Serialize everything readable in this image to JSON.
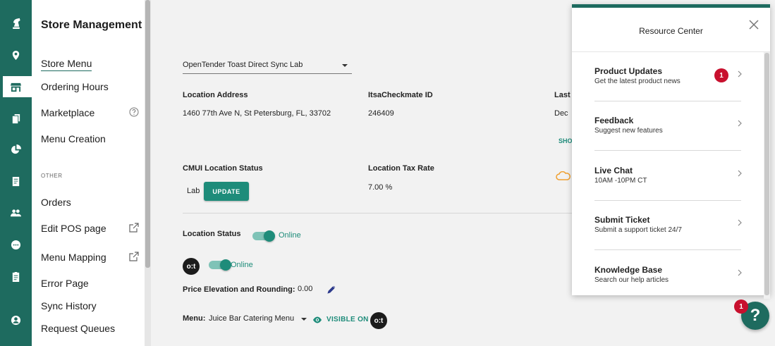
{
  "rail": {
    "items": [
      {
        "icon": "chess-knight-logo-icon"
      },
      {
        "icon": "location-pin-icon"
      },
      {
        "icon": "store-icon",
        "active": true
      },
      {
        "icon": "menu-board-icon"
      },
      {
        "icon": "pie-chart-icon"
      },
      {
        "icon": "receipt-icon"
      },
      {
        "icon": "users-icon"
      },
      {
        "icon": "chat-bubble-icon"
      },
      {
        "icon": "clipboard-icon"
      },
      {
        "icon": "account-icon"
      }
    ]
  },
  "sidebar": {
    "title": "Store Management",
    "items": [
      {
        "label": "Store Menu"
      },
      {
        "label": "Ordering Hours"
      },
      {
        "label": "Marketplace"
      },
      {
        "label": "Menu Creation"
      }
    ],
    "section_label": "OTHER",
    "other_items": [
      {
        "label": "Orders"
      },
      {
        "label": "Edit POS page"
      },
      {
        "label": "Menu Mapping"
      },
      {
        "label": "Error Page"
      },
      {
        "label": "Sync History"
      },
      {
        "label": "Request Queues"
      }
    ]
  },
  "main": {
    "location_select": "OpenTender Toast Direct Sync Lab",
    "address_label": "Location Address",
    "address_value": "1460 77th Ave N, St Petersburg, FL, 33702",
    "checkmate_label": "ItsaCheckmate ID",
    "checkmate_value": "246409",
    "last_label": "Last",
    "last_value": "Dec",
    "show_link": "SHO",
    "cmui_label": "CMUI Location Status",
    "cmui_value": "Lab",
    "update_button": "UPDATE",
    "tax_label": "Location Tax Rate",
    "tax_value": "7.00 %",
    "location_status_label": "Location Status",
    "location_status_value": "Online",
    "ot_logo_text": "o:t",
    "ot_status_value": "Online",
    "price_label": "Price Elevation and Rounding:",
    "price_value": "0.00",
    "menu_label": "Menu:",
    "menu_value": "Juice Bar Catering Menu",
    "visible_on": "VISIBLE ON"
  },
  "resource_center": {
    "title": "Resource Center",
    "items": [
      {
        "title": "Product Updates",
        "subtitle": "Get the latest product news",
        "badge": "1"
      },
      {
        "title": "Feedback",
        "subtitle": "Suggest new features"
      },
      {
        "title": "Live Chat",
        "subtitle": "10AM -10PM CT"
      },
      {
        "title": "Submit Ticket",
        "subtitle": "Submit a support ticket 24/7"
      },
      {
        "title": "Knowledge Base",
        "subtitle": "Search our help articles"
      }
    ]
  },
  "help": {
    "badge": "1",
    "symbol": "?"
  },
  "colors": {
    "brand": "#1e6b5f",
    "accent": "#1e8c7a",
    "badge": "#c8102e"
  }
}
